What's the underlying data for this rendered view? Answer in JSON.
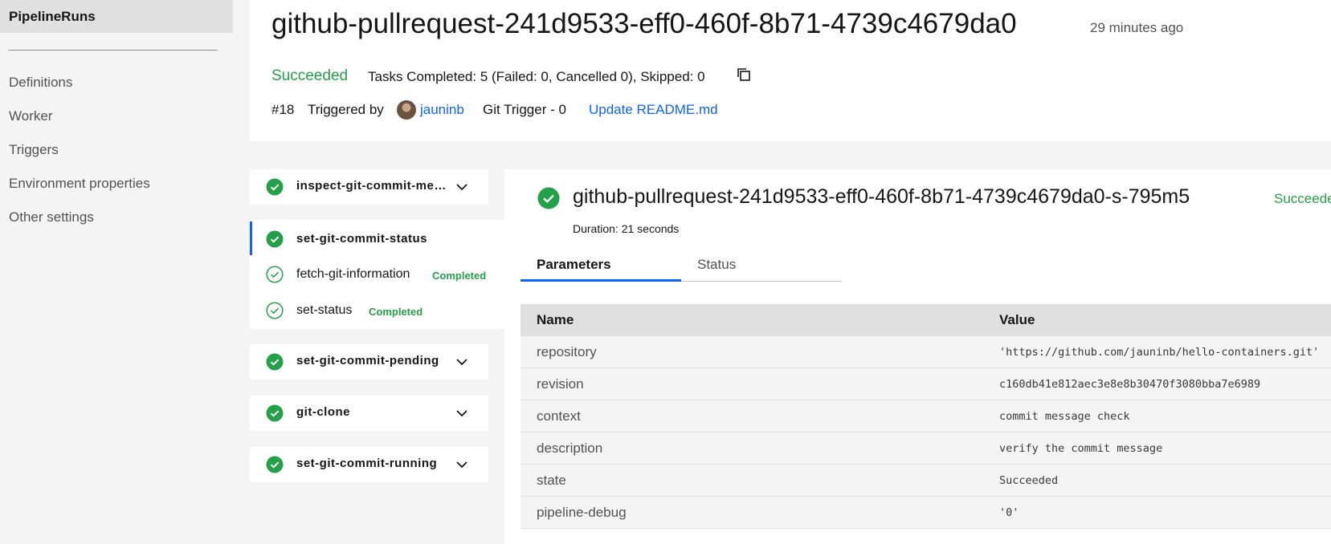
{
  "sidebar": {
    "active_label": "PipelineRuns",
    "items": [
      {
        "label": "Definitions"
      },
      {
        "label": "Worker"
      },
      {
        "label": "Triggers"
      },
      {
        "label": "Environment properties"
      },
      {
        "label": "Other settings"
      }
    ]
  },
  "header": {
    "title": "github-pullrequest-241d9533-eff0-460f-8b71-4739c4679da0",
    "time": "29 minutes ago",
    "status": "Succeeded",
    "tasks_summary": "Tasks Completed: 5 (Failed: 0, Cancelled 0), Skipped: 0",
    "run_number": "#18",
    "triggered_by_label": "Triggered by",
    "user": "jauninb",
    "trigger": "Git Trigger - 0",
    "commit_message": "Update README.md"
  },
  "tasks": [
    {
      "name": "inspect-git-commit-message"
    },
    {
      "name": "set-git-commit-pending"
    },
    {
      "name": "git-clone"
    },
    {
      "name": "set-git-commit-running"
    }
  ],
  "expanded_steps": [
    {
      "name": "set-git-commit-status",
      "status": ""
    },
    {
      "name": "fetch-git-information",
      "status": "Completed"
    },
    {
      "name": "set-status",
      "status": "Completed"
    }
  ],
  "detail": {
    "title": "github-pullrequest-241d9533-eff0-460f-8b71-4739c4679da0-s-795m5",
    "status": "Succeeded",
    "duration": "Duration: 21 seconds",
    "tabs": [
      {
        "label": "Parameters",
        "active": true
      },
      {
        "label": "Status",
        "active": false
      }
    ],
    "table": {
      "headers": {
        "name": "Name",
        "value": "Value"
      },
      "rows": [
        {
          "name": "repository",
          "value": "'https://github.com/jauninb/hello-containers.git'"
        },
        {
          "name": "revision",
          "value": "c160db41e812aec3e8e8b30470f3080bba7e6989"
        },
        {
          "name": "context",
          "value": "commit message check"
        },
        {
          "name": "description",
          "value": "verify the commit message"
        },
        {
          "name": "state",
          "value": "Succeeded"
        },
        {
          "name": "pipeline-debug",
          "value": "'0'"
        }
      ]
    }
  },
  "colors": {
    "success": "#24a148",
    "link": "#0f62fe",
    "active_bar": "#0f62fe"
  },
  "icons": {
    "task_status": "checkmark-filled-icon",
    "step_status": "checkmark-outline-icon",
    "expand": "chevron-down-icon",
    "copy": "copy-icon"
  }
}
